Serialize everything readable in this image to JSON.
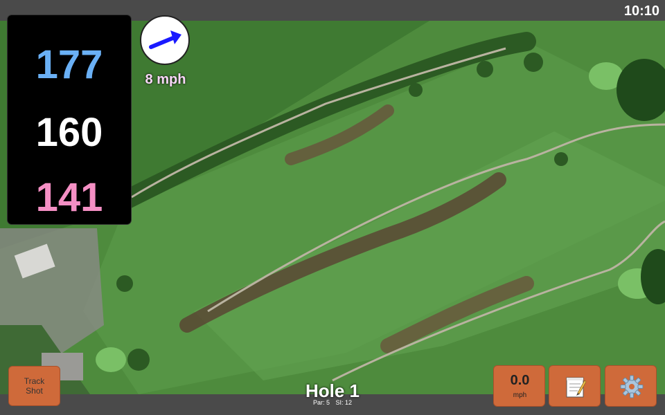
{
  "status": {
    "time": "10:10"
  },
  "distances": {
    "back": "177",
    "middle": "160",
    "front": "141"
  },
  "wind": {
    "speed": "8 mph",
    "arrow_color": "#1a1aff"
  },
  "hole": {
    "title": "Hole 1",
    "par": "Par: 5",
    "si": "SI: 12"
  },
  "buttons": {
    "track_shot_line1": "Track",
    "track_shot_line2": "Shot",
    "speed_value": "0.0",
    "speed_unit": "mph",
    "notes_icon": "notepad-icon",
    "settings_icon": "gear-icon"
  },
  "colors": {
    "button": "#cf6a3a",
    "back_distance": "#6ab0f5",
    "front_distance": "#f48fc4"
  }
}
